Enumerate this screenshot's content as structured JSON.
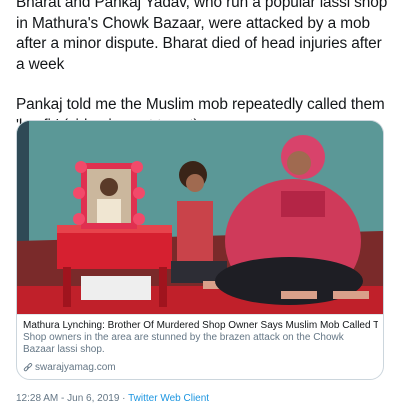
{
  "tweet": {
    "text_lines": [
      "Bharat and Pankaj Yadav, who run a popular lassi shop in Mathura's Chowk Bazaar, were attacked by a mob after a minor dispute. Bharat died of head injuries after a week",
      "Pankaj told me the Muslim mob repeatedly called them 'kaafir' (video in next tweet)"
    ],
    "timestamp": "12:28 AM - Jun 6, 2019",
    "separator": " · ",
    "source": "Twitter Web Client"
  },
  "card": {
    "title": "Mathura Lynching: Brother Of Murdered Shop Owner Says Muslim Mob Called Th...",
    "description": "Shop owners in the area are stunned by the brazen attack on the Chowk Bazaar lassi shop.",
    "domain": "swarajyamag.com",
    "domain_icon": "link-icon"
  },
  "colors": {
    "link": "#1b95e0",
    "secondary_text": "#657786",
    "card_border": "#ccd6dd"
  }
}
